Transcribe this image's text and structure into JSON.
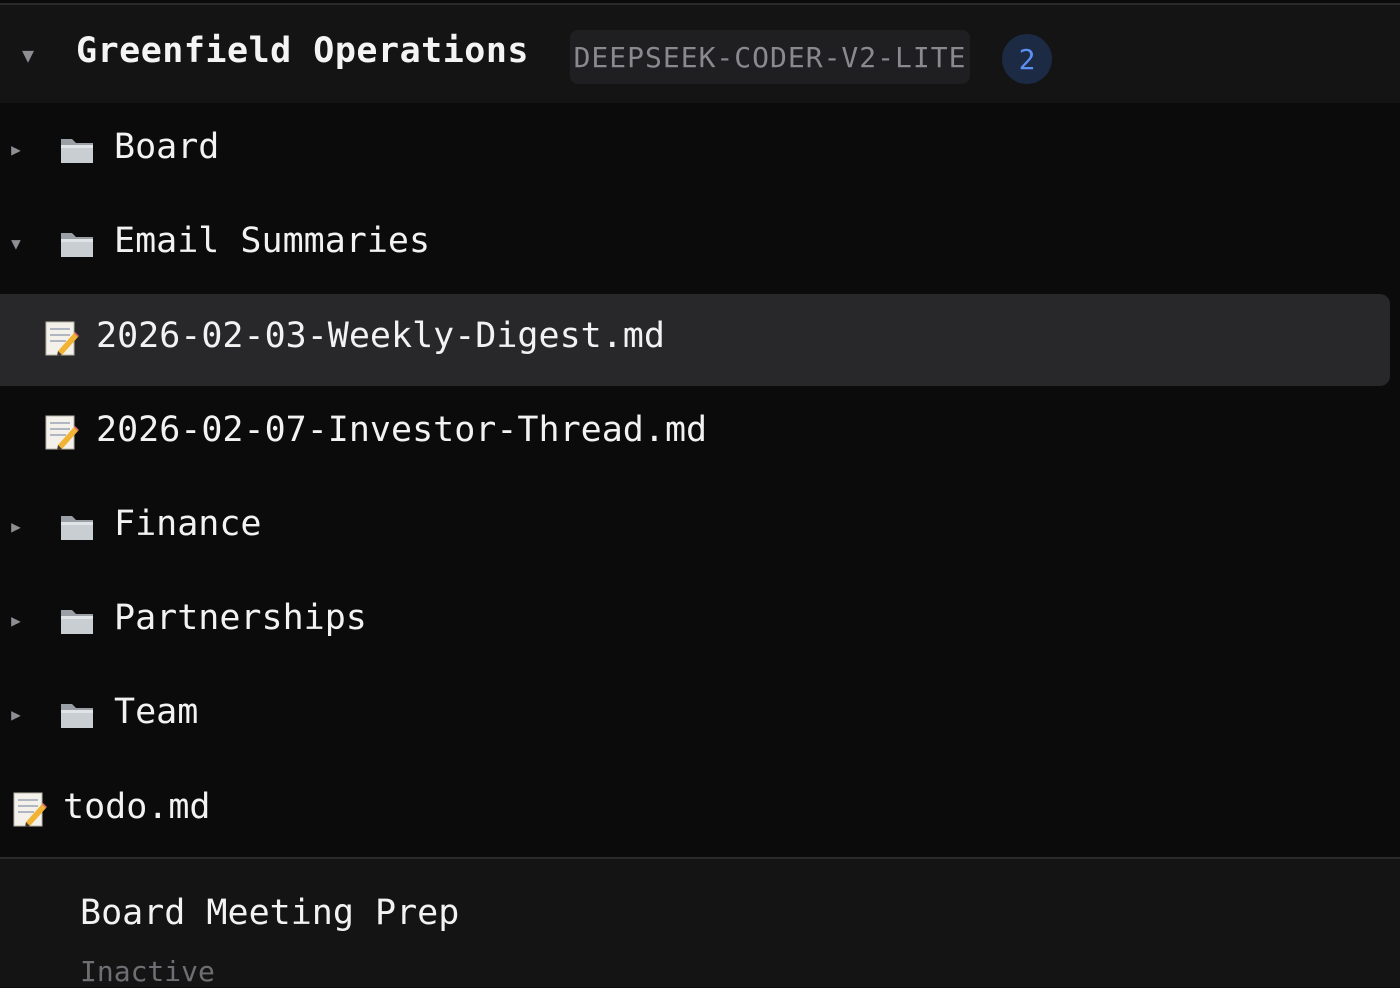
{
  "workspace": {
    "title": "Greenfield Operations",
    "model": "DEEPSEEK-CODER-V2-LITE",
    "count": "2"
  },
  "tree": [
    {
      "kind": "folder",
      "label": "Board",
      "expanded": false,
      "icon": "folder-icon"
    },
    {
      "kind": "folder",
      "label": "Email Summaries",
      "expanded": true,
      "icon": "folder-icon"
    },
    {
      "kind": "file",
      "label": "2026-02-03-Weekly-Digest.md",
      "selected": true,
      "icon": "memo-icon"
    },
    {
      "kind": "file",
      "label": "2026-02-07-Investor-Thread.md",
      "selected": false,
      "icon": "memo-icon"
    },
    {
      "kind": "folder",
      "label": "Finance",
      "expanded": false,
      "icon": "folder-icon"
    },
    {
      "kind": "folder",
      "label": "Partnerships",
      "expanded": false,
      "icon": "folder-icon"
    },
    {
      "kind": "folder",
      "label": "Team",
      "expanded": false,
      "icon": "folder-icon"
    },
    {
      "kind": "file",
      "label": "todo.md",
      "selected": false,
      "icon": "memo-icon"
    }
  ],
  "session": {
    "title": "Board Meeting Prep",
    "status": "Inactive"
  },
  "colors": {
    "background": "#0b0b0c",
    "header": "#141415",
    "selected_row": "#28282a",
    "badge_accent": "#5b8ff0"
  }
}
